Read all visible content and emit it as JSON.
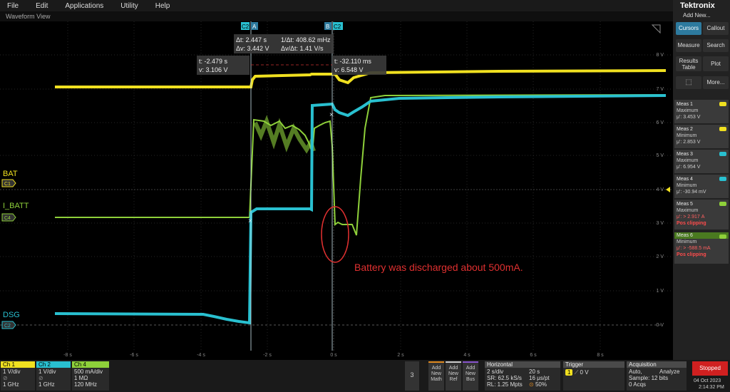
{
  "menu": [
    "File",
    "Edit",
    "Applications",
    "Utility",
    "Help"
  ],
  "view_title": "Waveform View",
  "brand": "Tektronix",
  "add_new": "Add New...",
  "buttons": {
    "cursors": "Cursors",
    "callout": "Callout",
    "measure": "Measure",
    "search": "Search",
    "results_table_1": "Results",
    "results_table_2": "Table",
    "plot": "Plot",
    "more": "More..."
  },
  "measurements": [
    {
      "title": "Meas 1",
      "type": "Maximum",
      "value": "μ': 3.453 V",
      "ch": "1",
      "color": "#f0e020",
      "clip": ""
    },
    {
      "title": "Meas 2",
      "type": "Minimum",
      "value": "μ': 2.853 V",
      "ch": "1",
      "color": "#f0e020",
      "clip": ""
    },
    {
      "title": "Meas 3",
      "type": "Maximum",
      "value": "μ': 6.954 V",
      "ch": "2",
      "color": "#29c0d0",
      "clip": ""
    },
    {
      "title": "Meas 4",
      "type": "Minimum",
      "value": "μ': -30.94 mV",
      "ch": "2",
      "color": "#29c0d0",
      "clip": ""
    },
    {
      "title": "Meas 5",
      "type": "Maximum",
      "value": "μ': > 2.917 A",
      "ch": "4",
      "color": "#8ed03a",
      "clip": "Pos clipping"
    },
    {
      "title": "Meas 6",
      "type": "Minimum",
      "value": "μ': > -588.5 mA",
      "ch": "4",
      "color": "#8ed03a",
      "clip": "Pos clipping"
    }
  ],
  "cursor_readouts": {
    "delta": {
      "dt": "Δt: 2.447 s",
      "inv_dt": "1/Δt: 408.62 mHz",
      "dv": "Δv: 3.442 V",
      "dvdt": "Δv/Δt: 1.41 V/s"
    },
    "a": {
      "t": "t: -2.479 s",
      "v": "v: 3.106 V"
    },
    "b": {
      "t": "t: -32.110 ms",
      "v": "v: 6.548 V"
    },
    "tag_a_ch": "C2",
    "tag_a": "A",
    "tag_b": "B",
    "tag_b_ch": "C2"
  },
  "channel_labels": [
    {
      "name": "BAT",
      "tag": "C1"
    },
    {
      "name": "I_BATT",
      "tag": "C4"
    },
    {
      "name": "DSG",
      "tag": "C2"
    }
  ],
  "annotation": "Battery was discharged about 500mA.",
  "y_ticks": [
    "8 V",
    "7 V",
    "6 V",
    "5 V",
    "4 V",
    "3 V",
    "2 V",
    "1 V",
    "0 V"
  ],
  "x_ticks": [
    "-8 s",
    "-6 s",
    "-4 s",
    "-2 s",
    "0 s",
    "2 s",
    "4 s",
    "6 s",
    "8 s"
  ],
  "ch_panels": [
    {
      "name": "Ch 1",
      "l1": "1 V/div",
      "l2": "1 GHz",
      "color": "#f0e020"
    },
    {
      "name": "Ch 2",
      "l1": "1 V/div",
      "l2": "1 GHz",
      "color": "#29c0d0"
    },
    {
      "name": "Ch 4",
      "l1": "500 mA/div",
      "l2": "1 MΩ",
      "l3": "120 MHz",
      "color": "#8ed03a"
    }
  ],
  "softkey_3": "3",
  "add_buttons": [
    {
      "l1": "Add",
      "l2": "New",
      "l3": "Math",
      "color": "#e08a20"
    },
    {
      "l1": "Add",
      "l2": "New",
      "l3": "Ref",
      "color": "#cccccc"
    },
    {
      "l1": "Add",
      "l2": "New",
      "l3": "Bus",
      "color": "#8855cc"
    }
  ],
  "horizontal": {
    "title": "Horizontal",
    "scale": "2 s/div",
    "span": "20 s",
    "sr": "SR: 62.5 kS/s",
    "pt": "16 μs/pt",
    "rl": "RL: 1.25 Mpts",
    "pos": "50%"
  },
  "trigger": {
    "title": "Trigger",
    "ch": "1",
    "level": "0 V"
  },
  "acquisition": {
    "title": "Acquisition",
    "mode": "Auto,",
    "analyze": "Analyze",
    "sample": "Sample: 12 bits",
    "acqs": "0 Acqs"
  },
  "status": {
    "stopped": "Stopped",
    "date": "04 Oct 2023",
    "time": "2:14:32 PM"
  }
}
